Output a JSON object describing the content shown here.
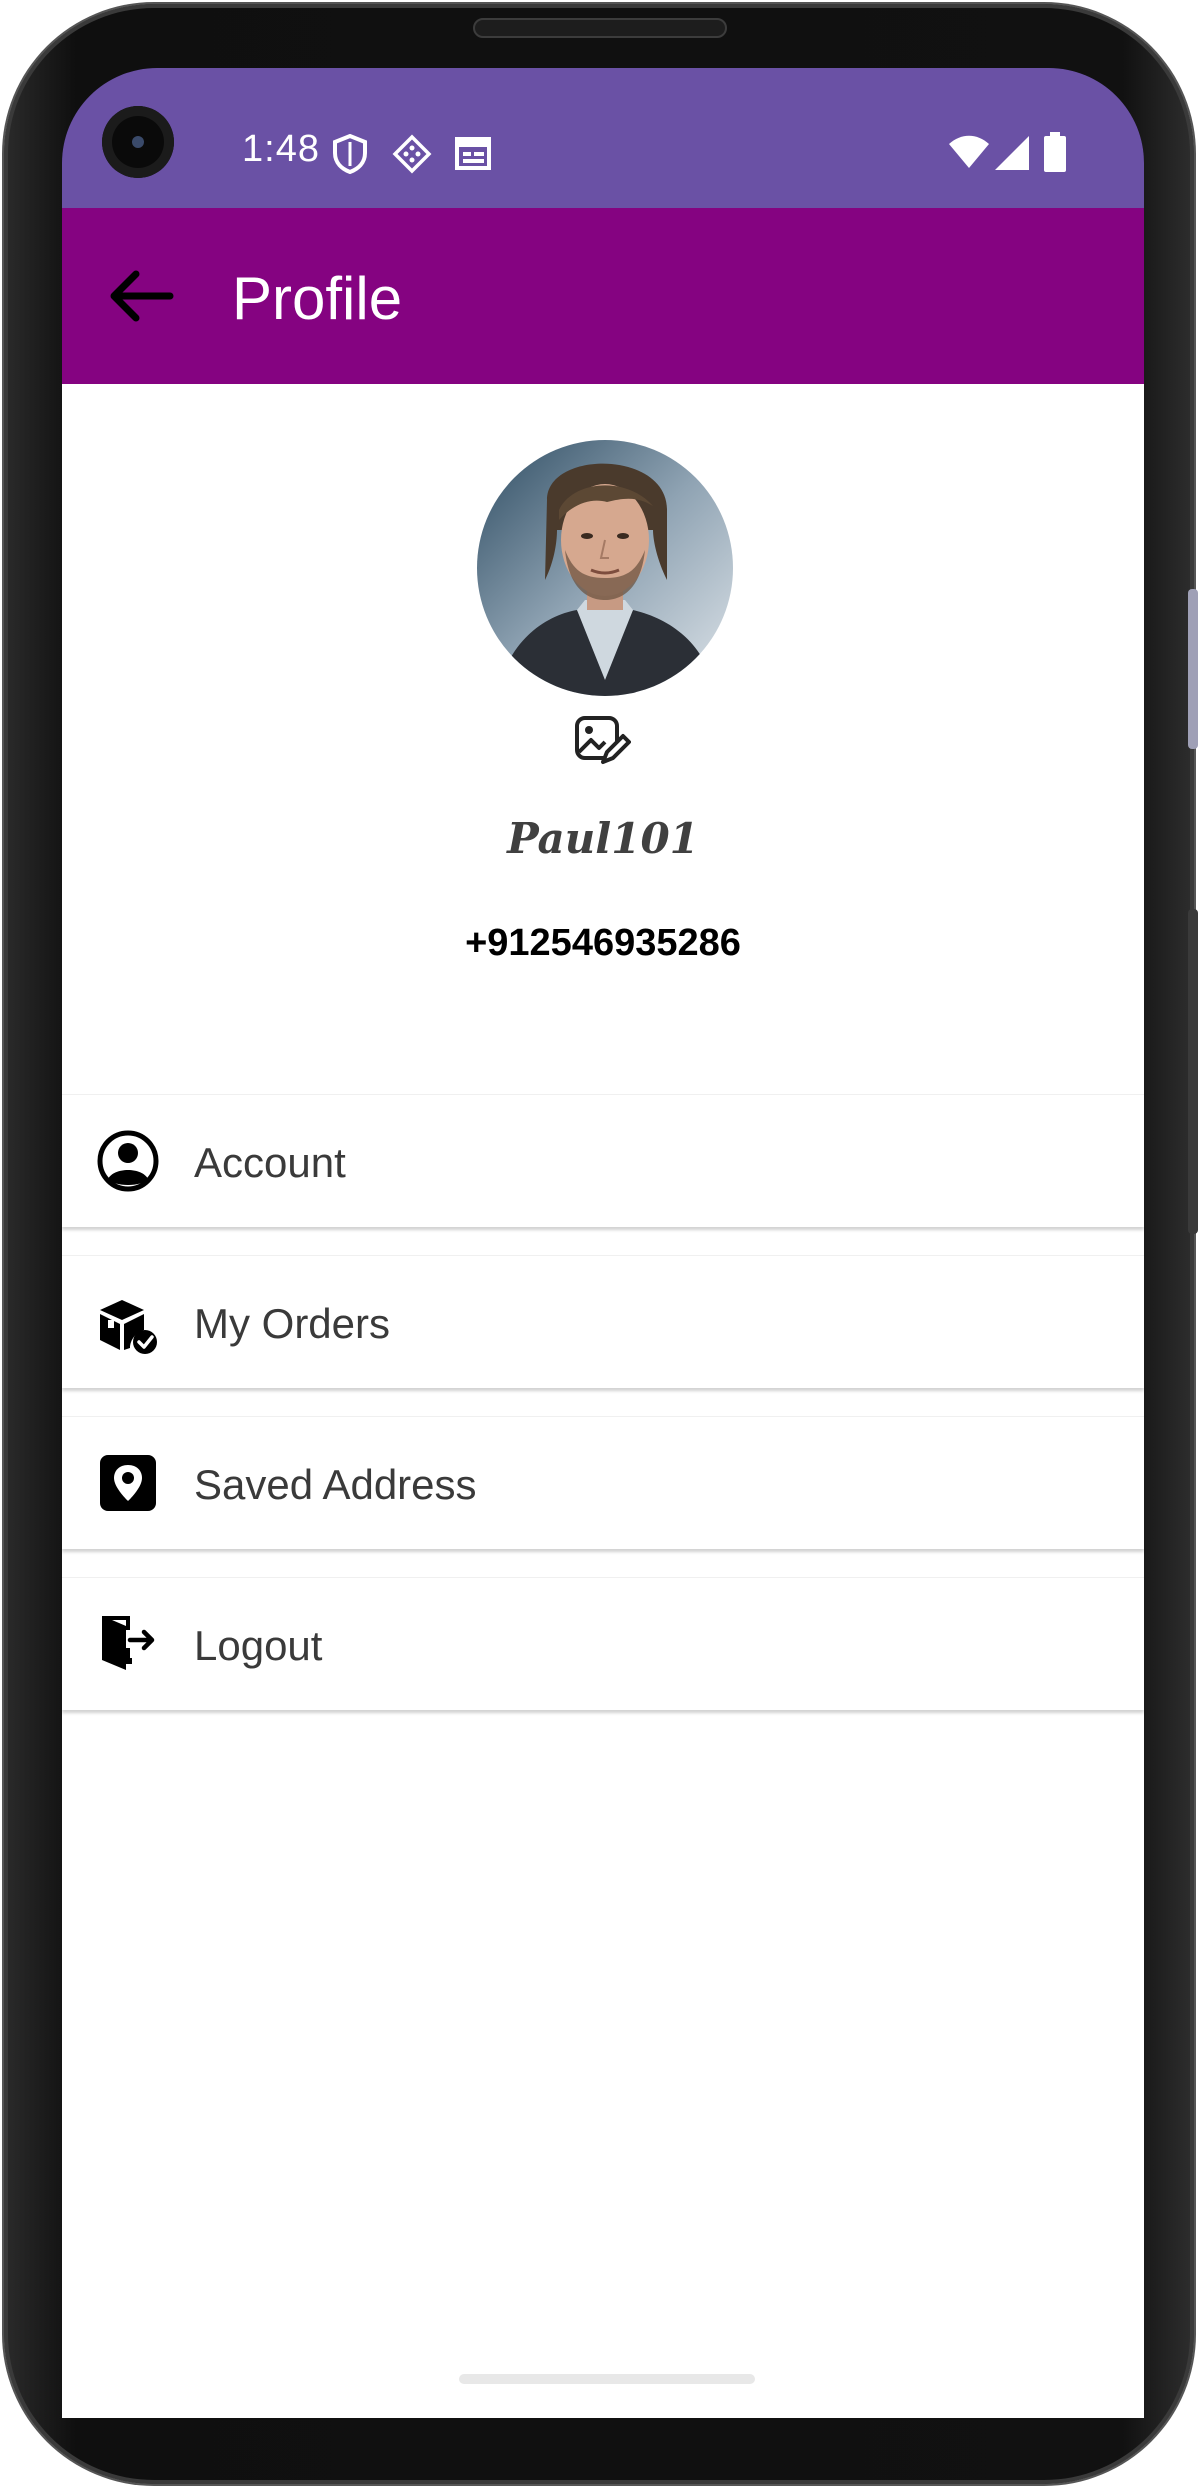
{
  "status_bar": {
    "time": "1:48",
    "icons": [
      "shield-icon",
      "diamond-grid-icon",
      "calendar-icon",
      "wifi-icon",
      "cell-signal-icon",
      "battery-icon"
    ],
    "color": "#6a51a5"
  },
  "app_bar": {
    "title": "Profile",
    "back_icon": "arrow-left-icon",
    "color": "#850381"
  },
  "profile": {
    "avatar": "profile-photo",
    "edit_icon": "edit-photo-icon",
    "username": "Paul101",
    "phone": "+912546935286"
  },
  "menu": {
    "items": [
      {
        "label": "Account",
        "icon": "account-circle-icon"
      },
      {
        "label": "My Orders",
        "icon": "orders-box-icon"
      },
      {
        "label": "Saved Address",
        "icon": "location-pin-icon"
      },
      {
        "label": "Logout",
        "icon": "logout-door-icon"
      }
    ]
  }
}
